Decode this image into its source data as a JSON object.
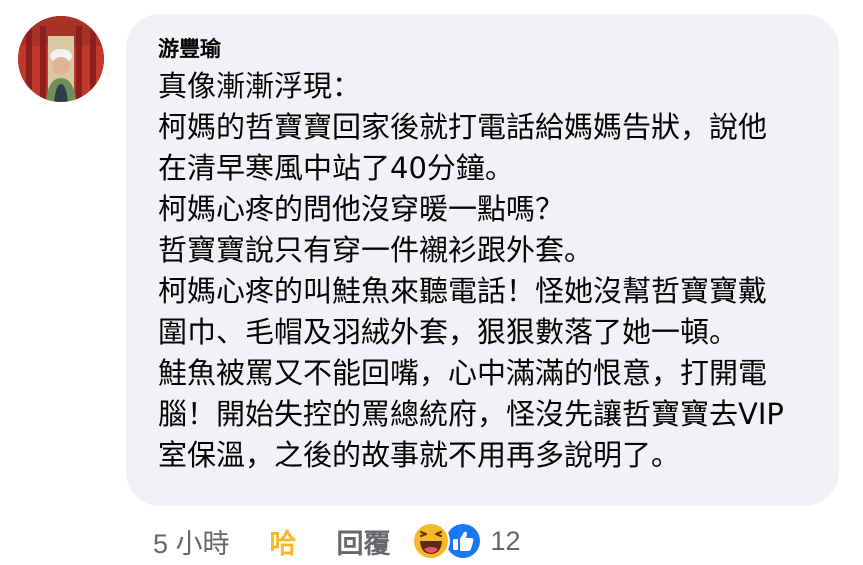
{
  "comment": {
    "author": "游豐瑜",
    "lines": [
      "真像漸漸浮現：",
      "柯媽的哲寶寶回家後就打電話給媽媽告狀，說他",
      "在清早寒風中站了40分鐘。",
      "柯媽心疼的問他沒穿暖一點嗎？",
      "哲寶寶說只有穿一件襯衫跟外套。",
      "柯媽心疼的叫鮭魚來聽電話！怪她沒幫哲寶寶戴",
      "圍巾、毛帽及羽絨外套，狠狠數落了她一頓。",
      "鮭魚被罵又不能回嘴，心中滿滿的恨意，打開電",
      "腦！開始失控的罵總統府，怪沒先讓哲寶寶去VIP",
      "室保溫，之後的故事就不用再多說明了。"
    ],
    "bubble_color": "#f0f2f5"
  },
  "actions": {
    "timestamp": "5 小時",
    "react_label": "哈",
    "react_color": "#f7b928",
    "reply_label": "回覆",
    "reactions": {
      "icons": [
        "haha-icon",
        "like-icon"
      ],
      "count": "12"
    }
  }
}
